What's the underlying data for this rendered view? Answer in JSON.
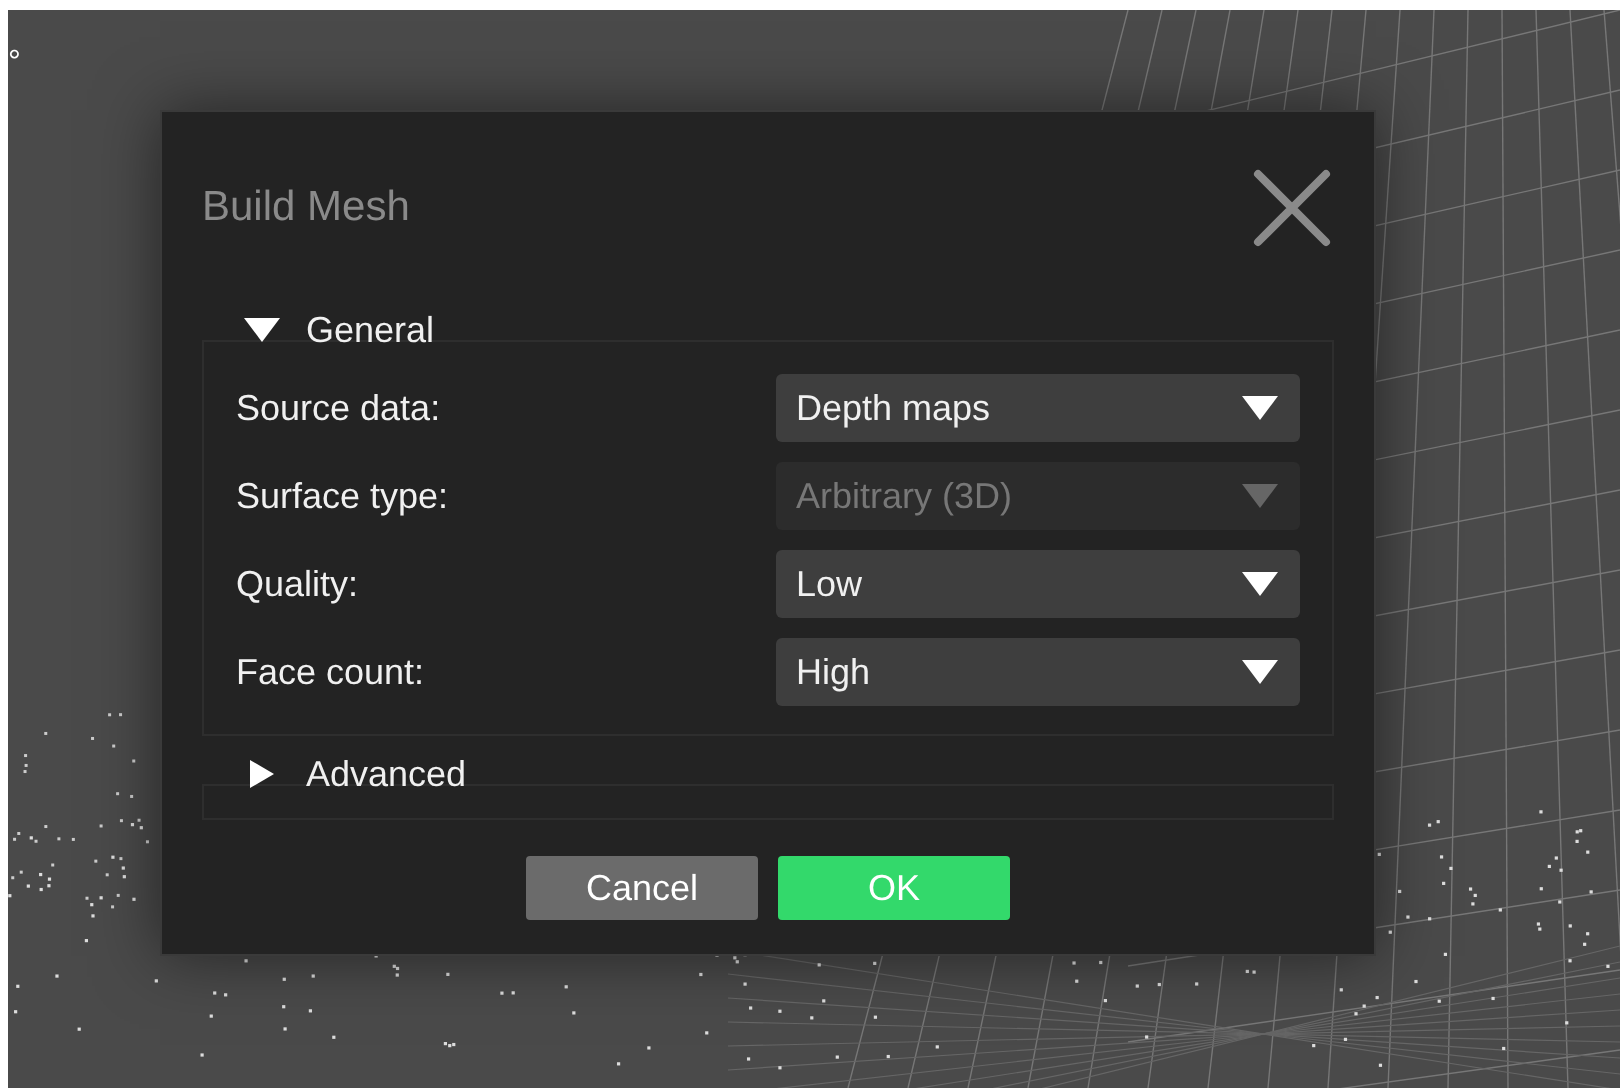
{
  "viewport": {
    "angle_label": "°"
  },
  "dialog": {
    "title": "Build Mesh",
    "sections": [
      {
        "title": "General",
        "expanded": true,
        "fields": [
          {
            "label": "Source data:",
            "value": "Depth maps",
            "disabled": false
          },
          {
            "label": "Surface type:",
            "value": "Arbitrary (3D)",
            "disabled": true
          },
          {
            "label": "Quality:",
            "value": "Low",
            "disabled": false
          },
          {
            "label": "Face count:",
            "value": "High",
            "disabled": false
          }
        ]
      },
      {
        "title": "Advanced",
        "expanded": false
      }
    ],
    "buttons": [
      {
        "label": "Cancel",
        "kind": "secondary"
      },
      {
        "label": "OK",
        "kind": "primary"
      }
    ]
  }
}
